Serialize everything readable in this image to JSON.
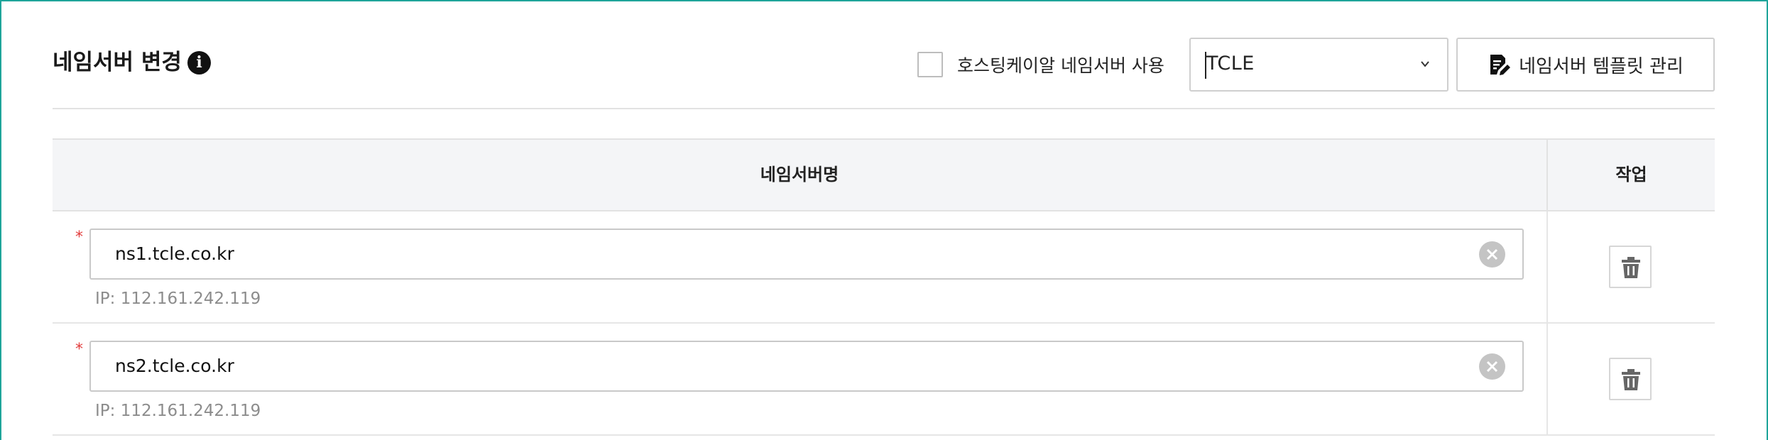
{
  "header": {
    "title": "네임서버 변경",
    "info_icon": "info-icon",
    "hosting_checkbox": {
      "label": "호스팅케이알 네임서버 사용",
      "checked": false
    },
    "template_select": {
      "value": "TCLE"
    },
    "template_button": {
      "label": "네임서버 템플릿 관리",
      "icon": "document-edit-icon"
    }
  },
  "table": {
    "columns": [
      "네임서버명",
      "작업"
    ],
    "rows": [
      {
        "required_mark": "*",
        "nameserver": "ns1.tcle.co.kr",
        "ip": "IP: 112.161.242.119"
      },
      {
        "required_mark": "*",
        "nameserver": "ns2.tcle.co.kr",
        "ip": "IP: 112.161.242.119"
      }
    ]
  },
  "colors": {
    "panel_border": "#1fa59a",
    "required": "#e23b3b",
    "header_bg": "#f4f5f7",
    "muted_text": "#8c8c8c"
  }
}
